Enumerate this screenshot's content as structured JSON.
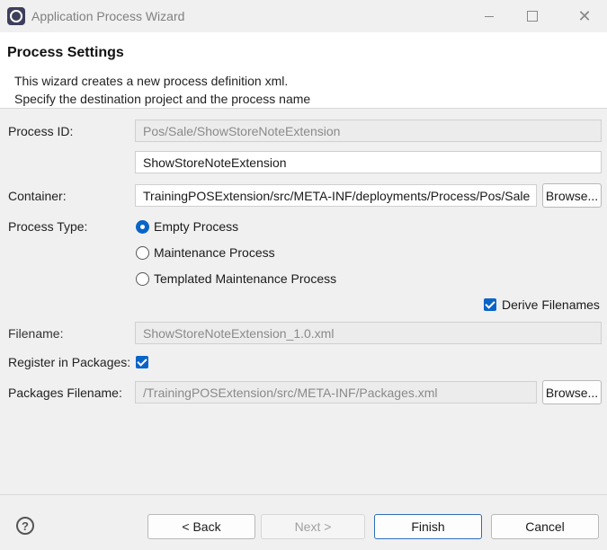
{
  "window": {
    "title": "Application Process Wizard",
    "close_glyph": "✕"
  },
  "header": {
    "title": "Process Settings",
    "description_line1": "This wizard creates a new process definition xml.",
    "description_line2": "Specify the destination project and the process name"
  },
  "form": {
    "process_id": {
      "label": "Process ID:",
      "prefix_value": "Pos/Sale/ShowStoreNoteExtension",
      "name_value": "ShowStoreNoteExtension"
    },
    "container": {
      "label": "Container:",
      "value": "TrainingPOSExtension/src/META-INF/deployments/Process/Pos/Sale",
      "browse_label": "Browse..."
    },
    "process_type": {
      "label": "Process Type:",
      "options": [
        {
          "label": "Empty Process",
          "selected": true
        },
        {
          "label": "Maintenance Process",
          "selected": false
        },
        {
          "label": "Templated Maintenance Process",
          "selected": false
        }
      ]
    },
    "derive_filenames": {
      "label": "Derive Filenames",
      "checked": true
    },
    "filename": {
      "label": "Filename:",
      "value": "ShowStoreNoteExtension_1.0.xml"
    },
    "register_in_packages": {
      "label": "Register in Packages:",
      "checked": true
    },
    "packages_filename": {
      "label": "Packages Filename:",
      "value": "/TrainingPOSExtension/src/META-INF/Packages.xml",
      "browse_label": "Browse..."
    }
  },
  "footer": {
    "help_glyph": "?",
    "back_label": "< Back",
    "next_label": "Next >",
    "finish_label": "Finish",
    "cancel_label": "Cancel"
  },
  "colors": {
    "accent": "#0a64c8",
    "header_bg": "#ffffff",
    "dialog_bg": "#f0f0f0"
  }
}
